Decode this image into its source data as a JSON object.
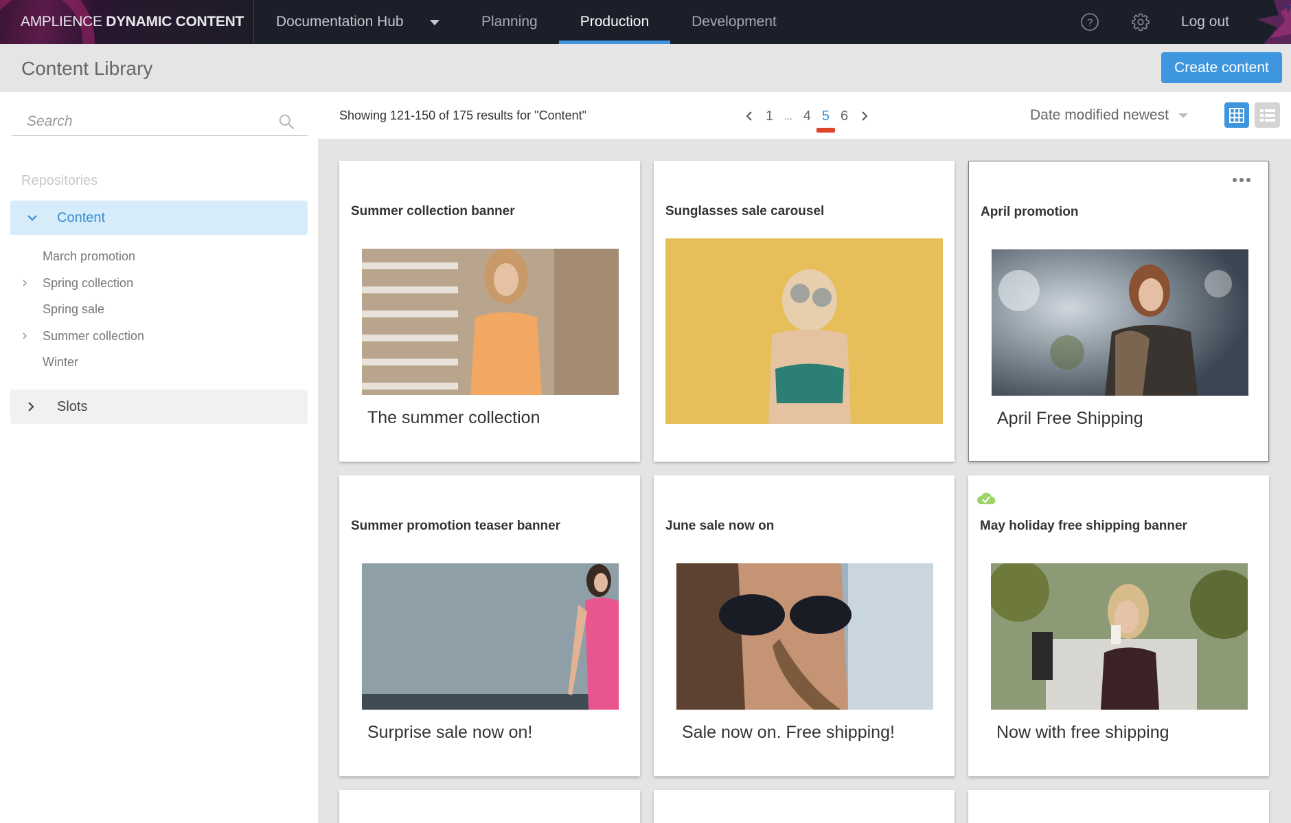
{
  "topbar": {
    "brand_light": "AMPLIENCE",
    "brand_bold": "DYNAMIC CONTENT",
    "hub": "Documentation Hub",
    "tabs": [
      {
        "label": "Planning",
        "active": false
      },
      {
        "label": "Production",
        "active": true
      },
      {
        "label": "Development",
        "active": false
      }
    ],
    "help_icon": "help-circle-icon",
    "settings_icon": "gear-icon",
    "logout": "Log out"
  },
  "header": {
    "title": "Content Library",
    "create_button": "Create content"
  },
  "sidebar": {
    "search_placeholder": "Search",
    "repositories_label": "Repositories",
    "repositories": [
      {
        "label": "Content",
        "expanded": true,
        "selected": true
      },
      {
        "label": "Slots",
        "expanded": false,
        "selected": false
      }
    ],
    "folders": [
      {
        "label": "March promotion",
        "has_children": false
      },
      {
        "label": "Spring collection",
        "has_children": true
      },
      {
        "label": "Spring sale",
        "has_children": false
      },
      {
        "label": "Summer collection",
        "has_children": true
      },
      {
        "label": "Winter",
        "has_children": false
      }
    ]
  },
  "toolbar": {
    "results_text": "Showing 121-150 of 175 results for \"Content\"",
    "pagination": {
      "pages": [
        "1",
        "...",
        "4",
        "5",
        "6"
      ],
      "current": "5"
    },
    "sort": "Date modified newest",
    "view_mode": "grid"
  },
  "cards": [
    {
      "title": "Summer collection banner",
      "caption": "The summer collection",
      "image": "woman in orange dress on stone steps",
      "selected": false,
      "status": null
    },
    {
      "title": "Sunglasses sale carousel",
      "caption": "",
      "image": "woman with round sunglasses against yellow wall",
      "selected": false,
      "status": null
    },
    {
      "title": "April promotion",
      "caption": "April Free Shipping",
      "image": "woman in fur coat in snow",
      "selected": true,
      "status": null
    },
    {
      "title": "Summer promotion teaser banner",
      "caption": "Surprise sale now on!",
      "image": "woman in pink dress against grey wall",
      "selected": false,
      "status": null
    },
    {
      "title": "June sale now on",
      "caption": "Sale now on. Free shipping!",
      "image": "woman in dark sunglasses close-up",
      "selected": false,
      "status": null
    },
    {
      "title": "May holiday free shipping banner",
      "caption": "Now with free shipping",
      "image": "woman with glasses drinking coffee in park",
      "selected": false,
      "status": "published"
    }
  ],
  "colors": {
    "accent": "#3d96de",
    "topbar": "#1b1f2a",
    "page_indicator": "#e0432c",
    "status_published": "#9dd46a"
  }
}
